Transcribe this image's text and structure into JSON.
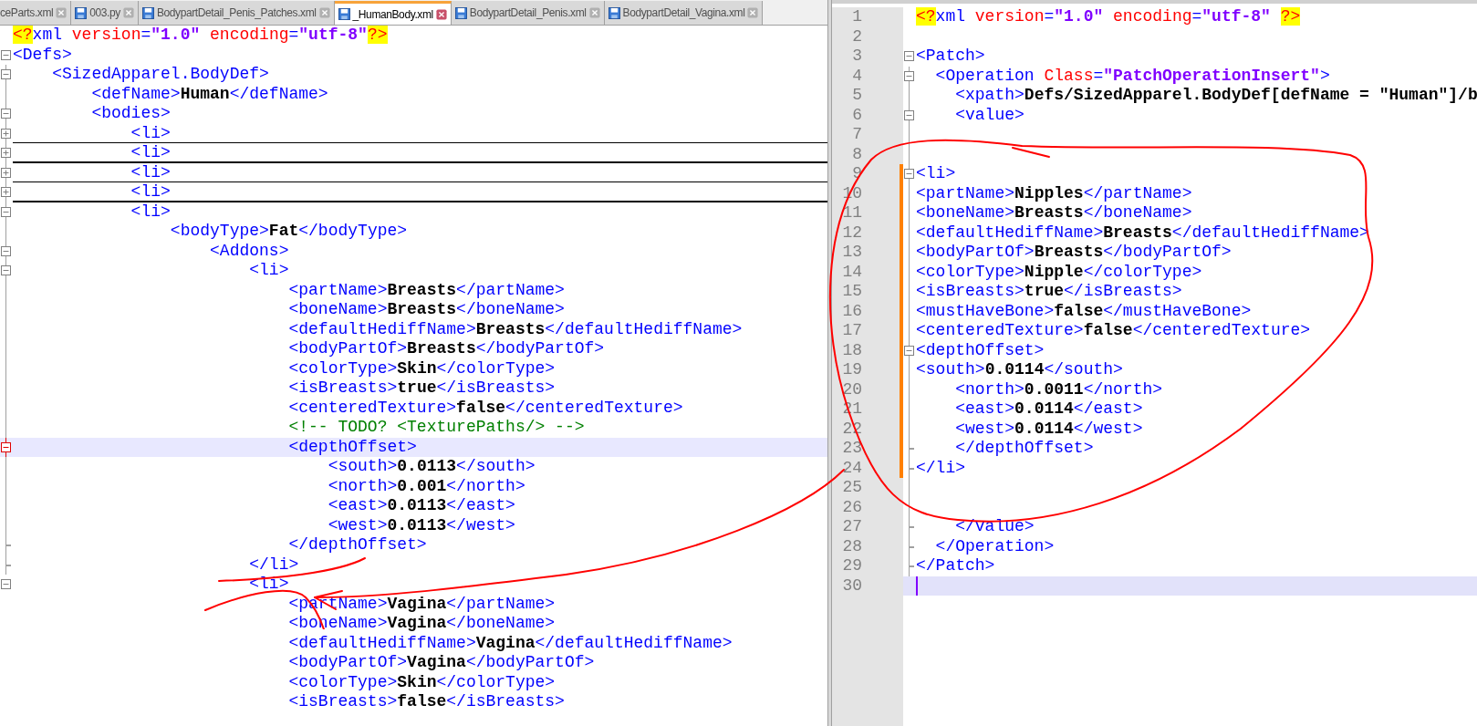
{
  "tabs": [
    {
      "label": "ceParts.xml",
      "selected": false
    },
    {
      "label": "003.py",
      "selected": false
    },
    {
      "label": "BodypartDetail_Penis_Patches.xml",
      "selected": false
    },
    {
      "label": "_HumanBody.xml",
      "selected": true
    },
    {
      "label": "BodypartDetail_Penis.xml",
      "selected": false
    },
    {
      "label": "BodypartDetail_Vagina.xml",
      "selected": false
    }
  ],
  "left_editor": {
    "lines": [
      {
        "kind": "plain",
        "folded": false,
        "current": false,
        "tokens": [
          {
            "kind": "pi",
            "text": "<?"
          },
          {
            "kind": "tag",
            "text": "xml"
          },
          {
            "kind": "attr",
            "text": " version"
          },
          {
            "kind": "tag",
            "text": "="
          },
          {
            "kind": "attrval",
            "text": "\"1.0\""
          },
          {
            "kind": "attr",
            "text": " encoding"
          },
          {
            "kind": "tag",
            "text": "="
          },
          {
            "kind": "attrval",
            "text": "\"utf-8\""
          },
          {
            "kind": "pi",
            "text": "?>"
          }
        ]
      },
      {
        "kind": "open",
        "folded": false,
        "current": false,
        "tokens": [
          {
            "kind": "tag",
            "text": "<Defs>"
          }
        ]
      },
      {
        "kind": "open",
        "folded": false,
        "current": false,
        "tokens": [
          {
            "kind": "tag",
            "text": "    <SizedApparel.BodyDef>"
          }
        ]
      },
      {
        "kind": "plain",
        "folded": false,
        "current": false,
        "tokens": [
          {
            "kind": "tag",
            "text": "        <defName>"
          },
          {
            "kind": "value",
            "text": "Human"
          },
          {
            "kind": "tag",
            "text": "</defName>"
          }
        ]
      },
      {
        "kind": "open",
        "folded": false,
        "current": false,
        "tokens": [
          {
            "kind": "tag",
            "text": "        <bodies>"
          }
        ]
      },
      {
        "kind": "closed",
        "folded": true,
        "current": false,
        "tokens": [
          {
            "kind": "tag",
            "text": "            <li>"
          }
        ]
      },
      {
        "kind": "closed",
        "folded": true,
        "current": false,
        "tokens": [
          {
            "kind": "tag",
            "text": "            <li>"
          }
        ]
      },
      {
        "kind": "closed",
        "folded": true,
        "current": false,
        "tokens": [
          {
            "kind": "tag",
            "text": "            <li>"
          }
        ]
      },
      {
        "kind": "closed",
        "folded": true,
        "current": false,
        "tokens": [
          {
            "kind": "tag",
            "text": "            <li>"
          }
        ]
      },
      {
        "kind": "open",
        "folded": false,
        "current": false,
        "tokens": [
          {
            "kind": "tag",
            "text": "            <li>"
          }
        ]
      },
      {
        "kind": "plain",
        "folded": false,
        "current": false,
        "tokens": [
          {
            "kind": "tag",
            "text": "                <bodyType>"
          },
          {
            "kind": "value",
            "text": "Fat"
          },
          {
            "kind": "tag",
            "text": "</bodyType>"
          }
        ]
      },
      {
        "kind": "open",
        "folded": false,
        "current": false,
        "tokens": [
          {
            "kind": "tag",
            "text": "                    <Addons>"
          }
        ]
      },
      {
        "kind": "open",
        "folded": false,
        "current": false,
        "tokens": [
          {
            "kind": "tag",
            "text": "                        <li>"
          }
        ]
      },
      {
        "kind": "plain",
        "folded": false,
        "current": false,
        "tokens": [
          {
            "kind": "tag",
            "text": "                            <partName>"
          },
          {
            "kind": "value",
            "text": "Breasts"
          },
          {
            "kind": "tag",
            "text": "</partName>"
          }
        ]
      },
      {
        "kind": "plain",
        "folded": false,
        "current": false,
        "tokens": [
          {
            "kind": "tag",
            "text": "                            <boneName>"
          },
          {
            "kind": "value",
            "text": "Breasts"
          },
          {
            "kind": "tag",
            "text": "</boneName>"
          }
        ]
      },
      {
        "kind": "plain",
        "folded": false,
        "current": false,
        "tokens": [
          {
            "kind": "tag",
            "text": "                            <defaultHediffName>"
          },
          {
            "kind": "value",
            "text": "Breasts"
          },
          {
            "kind": "tag",
            "text": "</defaultHediffName>"
          }
        ]
      },
      {
        "kind": "plain",
        "folded": false,
        "current": false,
        "tokens": [
          {
            "kind": "tag",
            "text": "                            <bodyPartOf>"
          },
          {
            "kind": "value",
            "text": "Breasts"
          },
          {
            "kind": "tag",
            "text": "</bodyPartOf>"
          }
        ]
      },
      {
        "kind": "plain",
        "folded": false,
        "current": false,
        "tokens": [
          {
            "kind": "tag",
            "text": "                            <colorType>"
          },
          {
            "kind": "value",
            "text": "Skin"
          },
          {
            "kind": "tag",
            "text": "</colorType>"
          }
        ]
      },
      {
        "kind": "plain",
        "folded": false,
        "current": false,
        "tokens": [
          {
            "kind": "tag",
            "text": "                            <isBreasts>"
          },
          {
            "kind": "value",
            "text": "true"
          },
          {
            "kind": "tag",
            "text": "</isBreasts>"
          }
        ]
      },
      {
        "kind": "plain",
        "folded": false,
        "current": false,
        "tokens": [
          {
            "kind": "tag",
            "text": "                            <centeredTexture>"
          },
          {
            "kind": "value",
            "text": "false"
          },
          {
            "kind": "tag",
            "text": "</centeredTexture>"
          }
        ]
      },
      {
        "kind": "plain",
        "folded": false,
        "current": false,
        "tokens": [
          {
            "kind": "comment",
            "text": "                            <!-- TODO? <TexturePaths/> -->"
          }
        ]
      },
      {
        "kind": "open",
        "folded": false,
        "current": true,
        "tokens": [
          {
            "kind": "tag",
            "text": "                            <depthOffset>"
          }
        ]
      },
      {
        "kind": "plain",
        "folded": false,
        "current": false,
        "tokens": [
          {
            "kind": "tag",
            "text": "                                <south>"
          },
          {
            "kind": "value",
            "text": "0.0113"
          },
          {
            "kind": "tag",
            "text": "</south>"
          }
        ]
      },
      {
        "kind": "plain",
        "folded": false,
        "current": false,
        "tokens": [
          {
            "kind": "tag",
            "text": "                                <north>"
          },
          {
            "kind": "value",
            "text": "0.001"
          },
          {
            "kind": "tag",
            "text": "</north>"
          }
        ]
      },
      {
        "kind": "plain",
        "folded": false,
        "current": false,
        "tokens": [
          {
            "kind": "tag",
            "text": "                                <east>"
          },
          {
            "kind": "value",
            "text": "0.0113"
          },
          {
            "kind": "tag",
            "text": "</east>"
          }
        ]
      },
      {
        "kind": "plain",
        "folded": false,
        "current": false,
        "tokens": [
          {
            "kind": "tag",
            "text": "                                <west>"
          },
          {
            "kind": "value",
            "text": "0.0113"
          },
          {
            "kind": "tag",
            "text": "</west>"
          }
        ]
      },
      {
        "kind": "end",
        "folded": false,
        "current": false,
        "tokens": [
          {
            "kind": "tag",
            "text": "                            </depthOffset>"
          }
        ]
      },
      {
        "kind": "end",
        "folded": false,
        "current": false,
        "tokens": [
          {
            "kind": "tag",
            "text": "                        </li>"
          }
        ]
      },
      {
        "kind": "open",
        "folded": false,
        "current": false,
        "tokens": [
          {
            "kind": "tag",
            "text": "                        <li>"
          }
        ]
      },
      {
        "kind": "plain",
        "folded": false,
        "current": false,
        "tokens": [
          {
            "kind": "tag",
            "text": "                            <partName>"
          },
          {
            "kind": "value",
            "text": "Vagina"
          },
          {
            "kind": "tag",
            "text": "</partName>"
          }
        ]
      },
      {
        "kind": "plain",
        "folded": false,
        "current": false,
        "tokens": [
          {
            "kind": "tag",
            "text": "                            <boneName>"
          },
          {
            "kind": "value",
            "text": "Vagina"
          },
          {
            "kind": "tag",
            "text": "</boneName>"
          }
        ]
      },
      {
        "kind": "plain",
        "folded": false,
        "current": false,
        "tokens": [
          {
            "kind": "tag",
            "text": "                            <defaultHediffName>"
          },
          {
            "kind": "value",
            "text": "Vagina"
          },
          {
            "kind": "tag",
            "text": "</defaultHediffName>"
          }
        ]
      },
      {
        "kind": "plain",
        "folded": false,
        "current": false,
        "tokens": [
          {
            "kind": "tag",
            "text": "                            <bodyPartOf>"
          },
          {
            "kind": "value",
            "text": "Vagina"
          },
          {
            "kind": "tag",
            "text": "</bodyPartOf>"
          }
        ]
      },
      {
        "kind": "plain",
        "folded": false,
        "current": false,
        "tokens": [
          {
            "kind": "tag",
            "text": "                            <colorType>"
          },
          {
            "kind": "value",
            "text": "Skin"
          },
          {
            "kind": "tag",
            "text": "</colorType>"
          }
        ]
      },
      {
        "kind": "plain",
        "folded": false,
        "current": false,
        "tokens": [
          {
            "kind": "tag",
            "text": "                            <isBreasts>"
          },
          {
            "kind": "value",
            "text": "false"
          },
          {
            "kind": "tag",
            "text": "</isBreasts>"
          }
        ]
      }
    ]
  },
  "right_editor": {
    "lines": [
      {
        "number": "1",
        "kind": "plain",
        "changed": false,
        "current": false,
        "tokens": [
          {
            "kind": "pi",
            "text": "<?"
          },
          {
            "kind": "tag",
            "text": "xml"
          },
          {
            "kind": "attr",
            "text": " version"
          },
          {
            "kind": "tag",
            "text": "="
          },
          {
            "kind": "attrval",
            "text": "\"1.0\""
          },
          {
            "kind": "attr",
            "text": " encoding"
          },
          {
            "kind": "tag",
            "text": "="
          },
          {
            "kind": "attrval",
            "text": "\"utf-8\" "
          },
          {
            "kind": "pi",
            "text": "?>"
          }
        ]
      },
      {
        "number": "2",
        "kind": "plain",
        "changed": false,
        "current": false
      },
      {
        "number": "3",
        "kind": "open",
        "changed": false,
        "current": false,
        "tokens": [
          {
            "kind": "tag",
            "text": "<Patch>"
          }
        ]
      },
      {
        "number": "4",
        "kind": "open",
        "changed": false,
        "current": false,
        "tokens": [
          {
            "kind": "tag",
            "text": "  <Operation"
          },
          {
            "kind": "attr",
            "text": " Class"
          },
          {
            "kind": "tag",
            "text": "="
          },
          {
            "kind": "attrval",
            "text": "\"PatchOperationInsert\""
          },
          {
            "kind": "tag",
            "text": ">"
          }
        ]
      },
      {
        "number": "5",
        "kind": "plain",
        "changed": false,
        "current": false,
        "tokens": [
          {
            "kind": "tag",
            "text": "    <xpath>"
          },
          {
            "kind": "value",
            "text": "Defs/SizedApparel.BodyDef[defName = \"Human\"]/b"
          }
        ]
      },
      {
        "number": "6",
        "kind": "open",
        "changed": false,
        "current": false,
        "tokens": [
          {
            "kind": "tag",
            "text": "    <value>"
          }
        ]
      },
      {
        "number": "7",
        "kind": "plain",
        "changed": false,
        "current": false
      },
      {
        "number": "8",
        "kind": "plain",
        "changed": false,
        "current": false
      },
      {
        "number": "9",
        "kind": "open",
        "changed": true,
        "current": false,
        "tokens": [
          {
            "kind": "tag",
            "text": "<li>"
          }
        ]
      },
      {
        "number": "10",
        "kind": "plain",
        "changed": true,
        "current": false,
        "tokens": [
          {
            "kind": "tag",
            "text": "<partName>"
          },
          {
            "kind": "value",
            "text": "Nipples"
          },
          {
            "kind": "tag",
            "text": "</partName>"
          }
        ]
      },
      {
        "number": "11",
        "kind": "plain",
        "changed": true,
        "current": false,
        "tokens": [
          {
            "kind": "tag",
            "text": "<boneName>"
          },
          {
            "kind": "value",
            "text": "Breasts"
          },
          {
            "kind": "tag",
            "text": "</boneName>"
          }
        ]
      },
      {
        "number": "12",
        "kind": "plain",
        "changed": true,
        "current": false,
        "tokens": [
          {
            "kind": "tag",
            "text": "<defaultHediffName>"
          },
          {
            "kind": "value",
            "text": "Breasts"
          },
          {
            "kind": "tag",
            "text": "</defaultHediffName>"
          }
        ]
      },
      {
        "number": "13",
        "kind": "plain",
        "changed": true,
        "current": false,
        "tokens": [
          {
            "kind": "tag",
            "text": "<bodyPartOf>"
          },
          {
            "kind": "value",
            "text": "Breasts"
          },
          {
            "kind": "tag",
            "text": "</bodyPartOf>"
          }
        ]
      },
      {
        "number": "14",
        "kind": "plain",
        "changed": true,
        "current": false,
        "tokens": [
          {
            "kind": "tag",
            "text": "<colorType>"
          },
          {
            "kind": "value",
            "text": "Nipple"
          },
          {
            "kind": "tag",
            "text": "</colorType>"
          }
        ]
      },
      {
        "number": "15",
        "kind": "plain",
        "changed": true,
        "current": false,
        "tokens": [
          {
            "kind": "tag",
            "text": "<isBreasts>"
          },
          {
            "kind": "value",
            "text": "true"
          },
          {
            "kind": "tag",
            "text": "</isBreasts>"
          }
        ]
      },
      {
        "number": "16",
        "kind": "plain",
        "changed": true,
        "current": false,
        "tokens": [
          {
            "kind": "tag",
            "text": "<mustHaveBone>"
          },
          {
            "kind": "value",
            "text": "false"
          },
          {
            "kind": "tag",
            "text": "</mustHaveBone>"
          }
        ]
      },
      {
        "number": "17",
        "kind": "plain",
        "changed": true,
        "current": false,
        "tokens": [
          {
            "kind": "tag",
            "text": "<centeredTexture>"
          },
          {
            "kind": "value",
            "text": "false"
          },
          {
            "kind": "tag",
            "text": "</centeredTexture>"
          }
        ]
      },
      {
        "number": "18",
        "kind": "open",
        "changed": true,
        "current": false,
        "tokens": [
          {
            "kind": "tag",
            "text": "<depthOffset>"
          }
        ]
      },
      {
        "number": "19",
        "kind": "plain",
        "changed": true,
        "current": false,
        "tokens": [
          {
            "kind": "tag",
            "text": "<south>"
          },
          {
            "kind": "value",
            "text": "0.0114"
          },
          {
            "kind": "tag",
            "text": "</south>"
          }
        ]
      },
      {
        "number": "20",
        "kind": "plain",
        "changed": true,
        "current": false,
        "tokens": [
          {
            "kind": "tag",
            "text": "    <north>"
          },
          {
            "kind": "value",
            "text": "0.0011"
          },
          {
            "kind": "tag",
            "text": "</north>"
          }
        ]
      },
      {
        "number": "21",
        "kind": "plain",
        "changed": true,
        "current": false,
        "tokens": [
          {
            "kind": "tag",
            "text": "    <east>"
          },
          {
            "kind": "value",
            "text": "0.0114"
          },
          {
            "kind": "tag",
            "text": "</east>"
          }
        ]
      },
      {
        "number": "22",
        "kind": "plain",
        "changed": true,
        "current": false,
        "tokens": [
          {
            "kind": "tag",
            "text": "    <west>"
          },
          {
            "kind": "value",
            "text": "0.0114"
          },
          {
            "kind": "tag",
            "text": "</west>"
          }
        ]
      },
      {
        "number": "23",
        "kind": "end",
        "changed": true,
        "current": false,
        "tokens": [
          {
            "kind": "tag",
            "text": "    </depthOffset>"
          }
        ]
      },
      {
        "number": "24",
        "kind": "end",
        "changed": true,
        "current": false,
        "tokens": [
          {
            "kind": "tag",
            "text": "</li>"
          }
        ]
      },
      {
        "number": "25",
        "kind": "plain",
        "changed": false,
        "current": false
      },
      {
        "number": "26",
        "kind": "plain",
        "changed": false,
        "current": false
      },
      {
        "number": "27",
        "kind": "end",
        "changed": false,
        "current": false,
        "tokens": [
          {
            "kind": "tag",
            "text": "    </value>"
          }
        ]
      },
      {
        "number": "28",
        "kind": "end",
        "changed": false,
        "current": false,
        "tokens": [
          {
            "kind": "tag",
            "text": "  </Operation>"
          }
        ]
      },
      {
        "number": "29",
        "kind": "end",
        "changed": false,
        "current": false,
        "tokens": [
          {
            "kind": "tag",
            "text": "</Patch>"
          }
        ]
      },
      {
        "number": "30",
        "kind": "plain",
        "changed": false,
        "current": true
      }
    ]
  }
}
